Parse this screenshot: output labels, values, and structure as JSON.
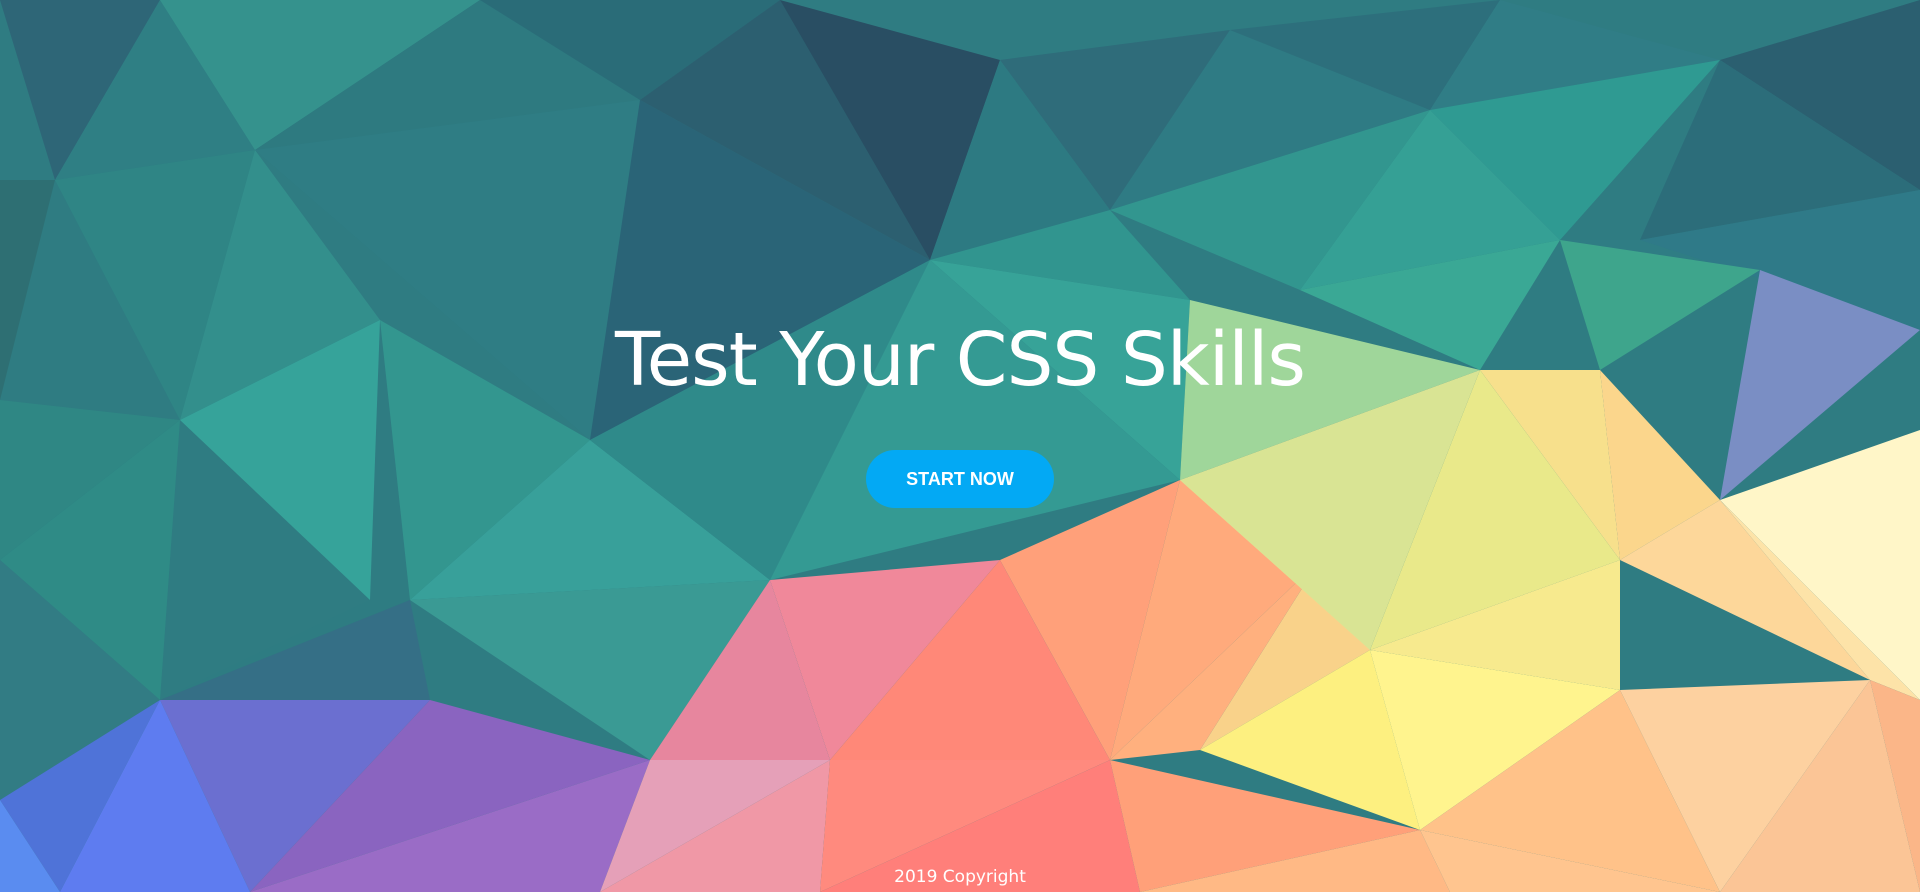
{
  "hero": {
    "title": "Test Your CSS Skills",
    "cta_label": "START NOW",
    "colors": {
      "button": "#03a9f4",
      "text": "#ffffff",
      "teal": "#2f8f8f",
      "dark_teal": "#2c5566",
      "coral": "#ff7e70",
      "yellow": "#fdf58a",
      "purple": "#8a6ac8"
    }
  },
  "footer": {
    "copyright": "2019 Copyright"
  }
}
